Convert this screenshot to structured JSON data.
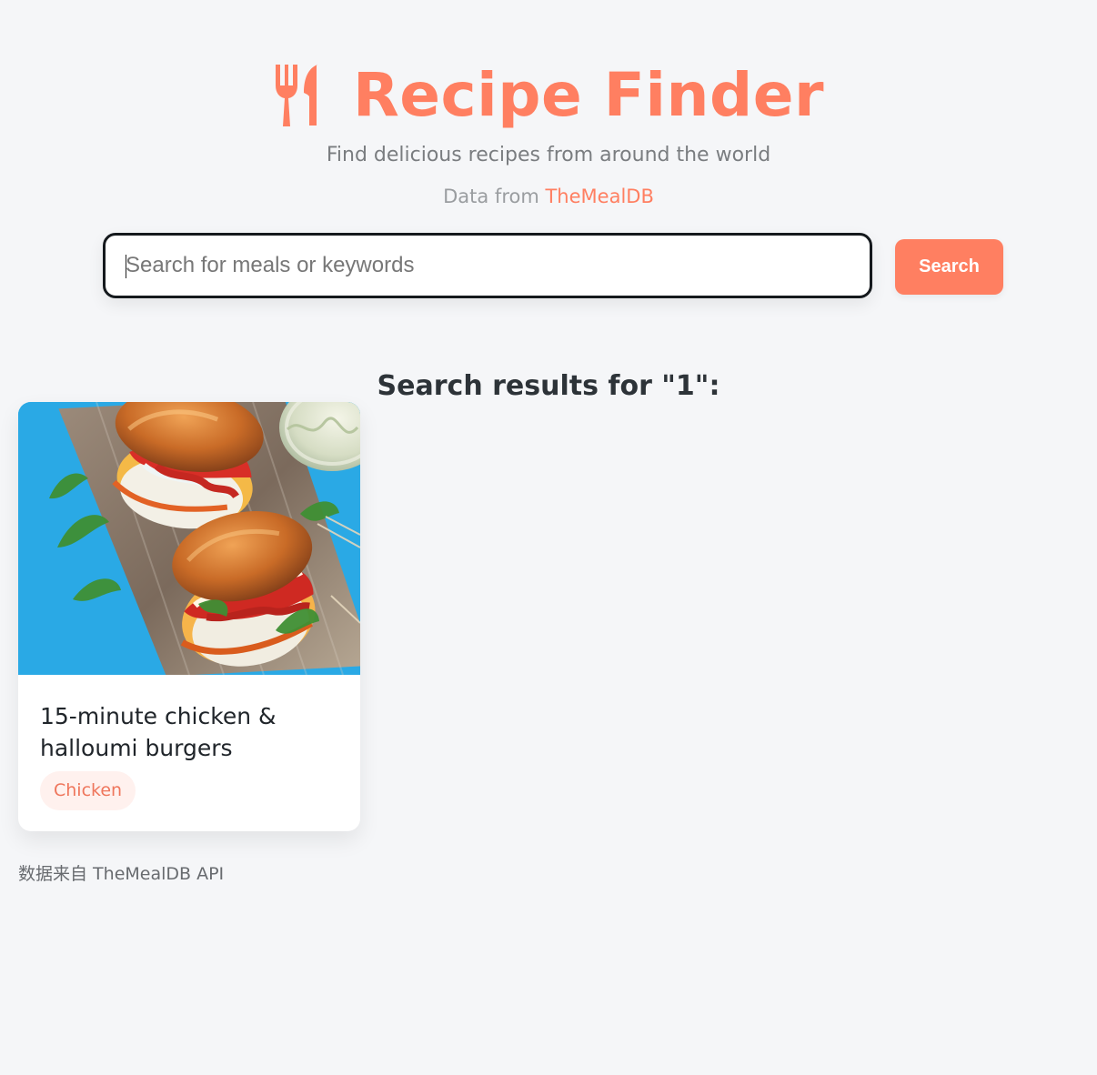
{
  "brand": {
    "title": "Recipe Finder",
    "subtitle": "Find delicious recipes from around the world",
    "source_prefix": "Data from",
    "source_link": "TheMealDB",
    "icon": "utensils-icon",
    "accent_color": "#ff7f61"
  },
  "search": {
    "placeholder": "Search for meals or keywords",
    "value": "",
    "button_label": "Search"
  },
  "results": {
    "heading": "Search results for \"1\":",
    "items": [
      {
        "title": "15-minute chicken & halloumi burgers",
        "category": "Chicken",
        "image": "chicken-halloumi-burger-image"
      }
    ]
  },
  "footer": {
    "note": "数据来自 TheMealDB API"
  },
  "colors": {
    "background": "#f5f6f8",
    "search_border": "#15191d",
    "category_pill_bg": "#fff1ee",
    "category_pill_text": "#ef765c"
  }
}
